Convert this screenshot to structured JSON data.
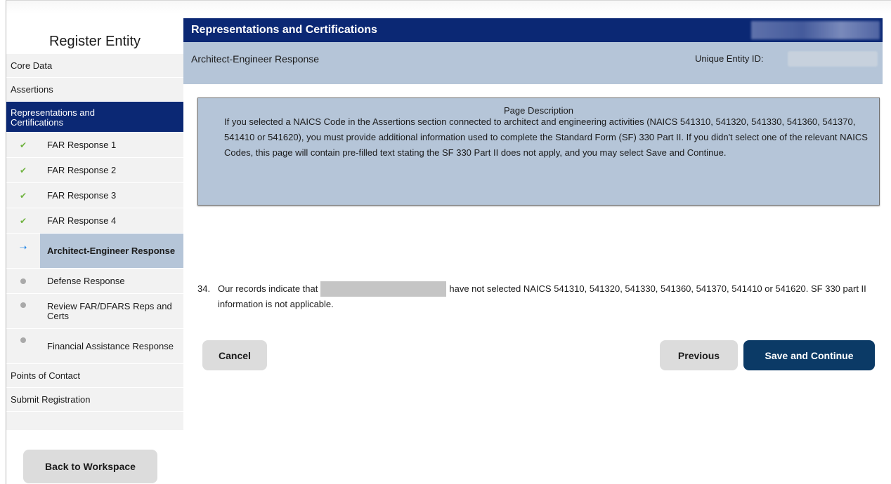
{
  "sidebar": {
    "title": "Register Entity",
    "items": [
      {
        "label": "Core Data"
      },
      {
        "label": "Assertions"
      },
      {
        "label": "Representations and Certifications"
      }
    ],
    "subitems": [
      {
        "label": "FAR Response 1",
        "status": "complete"
      },
      {
        "label": "FAR Response 2",
        "status": "complete"
      },
      {
        "label": "FAR Response 3",
        "status": "complete"
      },
      {
        "label": "FAR Response 4",
        "status": "complete"
      },
      {
        "label": "Architect-Engineer Response",
        "status": "current"
      },
      {
        "label": "Defense Response",
        "status": "pending"
      },
      {
        "label": "Review FAR/DFARS Reps and Certs",
        "status": "pending"
      },
      {
        "label": "Financial Assistance Response",
        "status": "pending"
      }
    ],
    "after_items": [
      {
        "label": "Points of Contact"
      },
      {
        "label": "Submit Registration"
      }
    ],
    "back_button": "Back to Workspace"
  },
  "main": {
    "header": "Representations and Certifications",
    "page_name": "Architect-Engineer Response",
    "ueid_label": "Unique Entity ID:",
    "description": {
      "title": "Page Description",
      "text": "If you selected a NAICS Code in the Assertions section connected to architect and engineering activities (NAICS 541310, 541320, 541330, 541360, 541370, 541410 or 541620), you must provide additional information used to complete the Standard Form (SF) 330 Part II. If you didn't select one of the relevant NAICS Codes, this page will contain pre-filled text stating the SF 330 Part II does not apply, and you may select Save and Continue."
    },
    "question": {
      "number": "34.",
      "before": "Our records indicate that",
      "after": "have not selected NAICS 541310, 541320, 541330, 541360, 541370, 541410 or 541620. SF 330 part II information is not applicable."
    },
    "buttons": {
      "cancel": "Cancel",
      "previous": "Previous",
      "save": "Save and Continue"
    }
  },
  "colors": {
    "navy": "#0b2874",
    "light_blue": "#b5c5d8",
    "save_button": "#0b3a66",
    "check_green": "#70b340",
    "arrow_blue": "#2a8ae6"
  }
}
